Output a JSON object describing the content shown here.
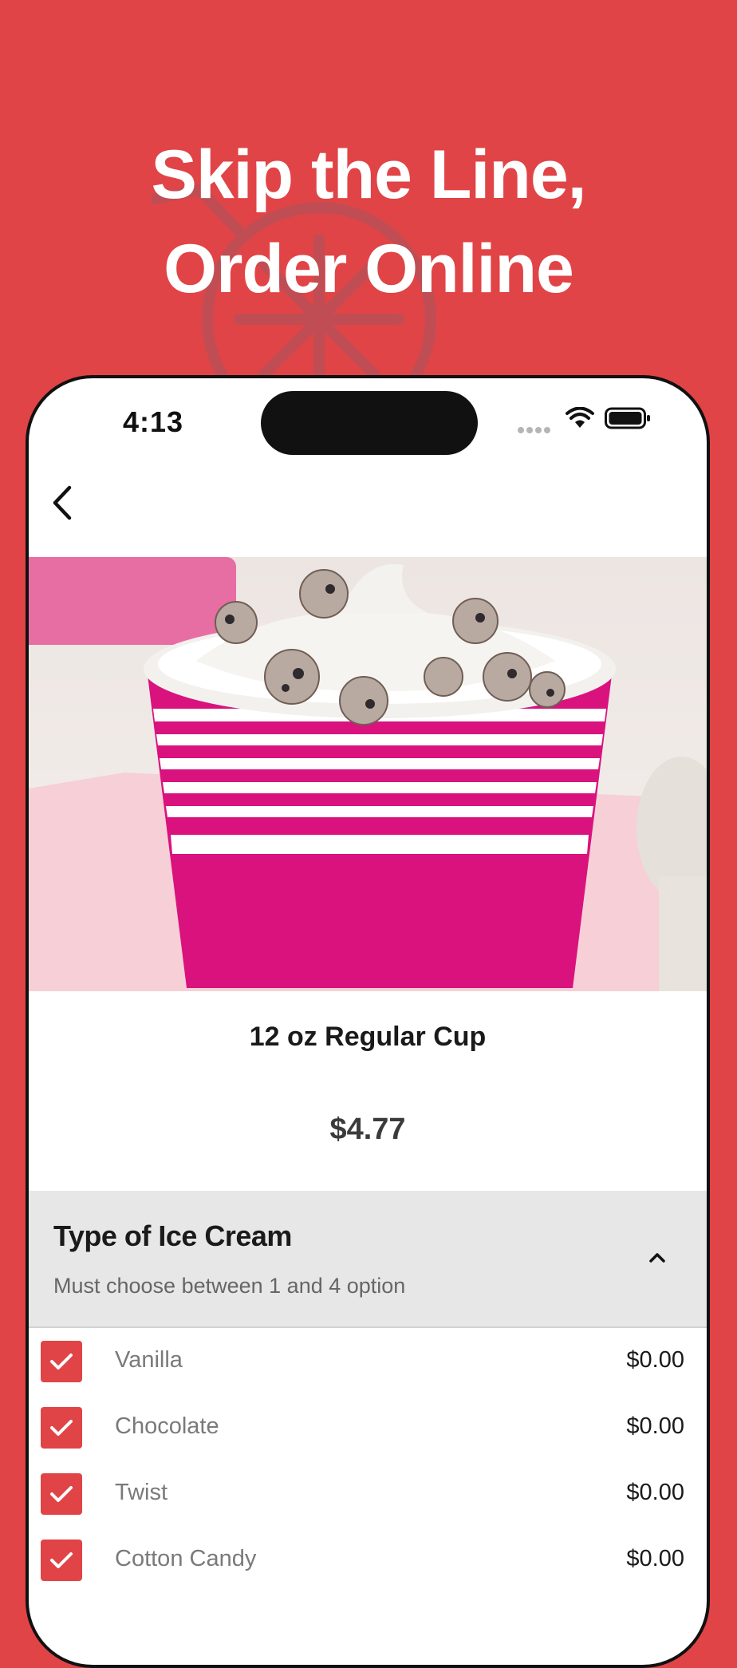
{
  "promo": {
    "headline_line1": "Skip the Line,",
    "headline_line2": "Order Online",
    "background_color": "#E04446",
    "background_icon": "ice-cream-shop-icon"
  },
  "status_bar": {
    "time": "4:13",
    "icons": [
      "signal-icon",
      "wifi-icon",
      "battery-icon"
    ]
  },
  "nav": {
    "back_icon": "chevron-left-icon"
  },
  "product": {
    "image_subject": "frozen-yogurt-cup-photo",
    "name": "12 oz Regular Cup",
    "price": "$4.77"
  },
  "option_group": {
    "title": "Type of Ice Cream",
    "subtitle": "Must choose between 1 and 4 option",
    "collapse_icon": "chevron-up-icon",
    "accent_color": "#E04446",
    "items": [
      {
        "label": "Vanilla",
        "price": "$0.00",
        "checked": true
      },
      {
        "label": "Chocolate",
        "price": "$0.00",
        "checked": true
      },
      {
        "label": "Twist",
        "price": "$0.00",
        "checked": true
      },
      {
        "label": "Cotton Candy",
        "price": "$0.00",
        "checked": true
      }
    ]
  }
}
